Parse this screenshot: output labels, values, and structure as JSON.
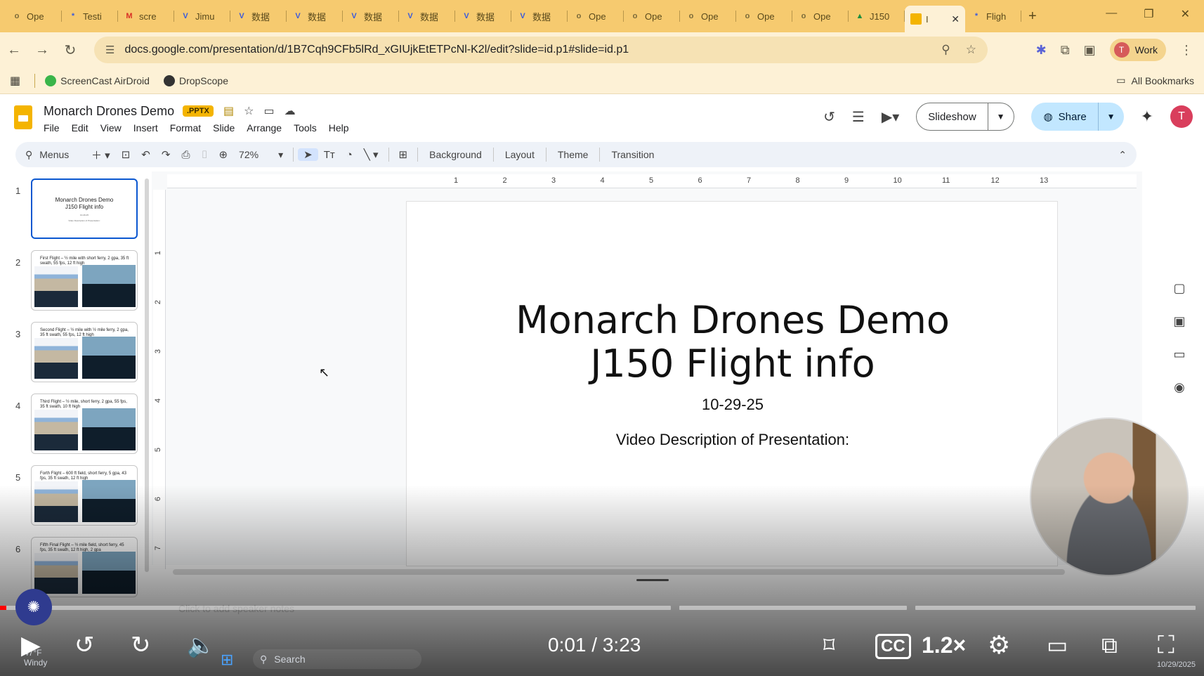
{
  "browser": {
    "tabs": [
      {
        "label": "Ope",
        "fav": "o",
        "color": "#7a6a3a"
      },
      {
        "label": "Testi",
        "fav": "*",
        "color": "#3b5bdb"
      },
      {
        "label": "scre",
        "fav": "M",
        "color": "#d93025"
      },
      {
        "label": "Jimu",
        "fav": "V",
        "color": "#3b5bdb"
      },
      {
        "label": "数据",
        "fav": "V",
        "color": "#3b5bdb"
      },
      {
        "label": "数据",
        "fav": "V",
        "color": "#3b5bdb"
      },
      {
        "label": "数据",
        "fav": "V",
        "color": "#3b5bdb"
      },
      {
        "label": "数据",
        "fav": "V",
        "color": "#3b5bdb"
      },
      {
        "label": "数据",
        "fav": "V",
        "color": "#3b5bdb"
      },
      {
        "label": "数据",
        "fav": "V",
        "color": "#3b5bdb"
      },
      {
        "label": "Ope",
        "fav": "o",
        "color": "#7a6a3a"
      },
      {
        "label": "Ope",
        "fav": "o",
        "color": "#7a6a3a"
      },
      {
        "label": "Ope",
        "fav": "o",
        "color": "#7a6a3a"
      },
      {
        "label": "Ope",
        "fav": "o",
        "color": "#7a6a3a"
      },
      {
        "label": "Ope",
        "fav": "o",
        "color": "#7a6a3a"
      },
      {
        "label": "J150",
        "fav": "▲",
        "color": "#1e8e3e"
      }
    ],
    "active_tab": {
      "label": "I"
    },
    "last_tab": {
      "label": "Fligh"
    },
    "url": "docs.google.com/presentation/d/1B7Cqh9CFb5lRd_xGIUjkEtETPcNl-K2l/edit?slide=id.p1#slide=id.p1",
    "profile_label": "Work",
    "profile_initial": "T",
    "bookmarks": [
      {
        "label": "ScreenCast AirDroid",
        "color": "#3ab54a"
      },
      {
        "label": "DropScope",
        "color": "#333333"
      }
    ],
    "all_bookmarks": "All Bookmarks"
  },
  "slides_app": {
    "title": "Monarch Drones Demo",
    "badge": ".PPTX",
    "menu": [
      "File",
      "Edit",
      "View",
      "Insert",
      "Format",
      "Slide",
      "Arrange",
      "Tools",
      "Help"
    ],
    "slideshow_label": "Slideshow",
    "share_label": "Share",
    "user_initial": "T",
    "toolbar": {
      "search_label": "Menus",
      "zoom": "72%",
      "background": "Background",
      "layout": "Layout",
      "theme": "Theme",
      "transition": "Transition"
    },
    "ruler_h": [
      "1",
      "2",
      "3",
      "4",
      "5",
      "6",
      "7",
      "8",
      "9",
      "10",
      "11",
      "12",
      "13"
    ],
    "ruler_v": [
      "1",
      "2",
      "3",
      "4",
      "5",
      "6",
      "7"
    ],
    "thumbnails": [
      {
        "num": "1",
        "kind": "title",
        "line1": "Monarch Drones Demo",
        "line2": "J150 Flight info",
        "date": "10-29-25",
        "desc": "Video Description of Presentation:"
      },
      {
        "num": "2",
        "kind": "content",
        "caption": "First Flight – ½ mile with short ferry, 2 gpa, 35 ft swath, 55 fps, 12 ft high"
      },
      {
        "num": "3",
        "kind": "content",
        "caption": "Second Flight – ½ mile with ½ mile ferry, 2 gpa, 35 ft swath, 55 fps, 12 ft high"
      },
      {
        "num": "4",
        "kind": "content",
        "caption": "Third Flight – ½ mile, short ferry, 2 gpa, 55 fps, 35 ft swath, 10 ft high"
      },
      {
        "num": "5",
        "kind": "content",
        "caption": "Forth Flight – 600 ft field, short ferry, 5 gpa, 43 fps, 35 ft swath, 12 ft high"
      },
      {
        "num": "6",
        "kind": "content",
        "caption": "Fifth Final Flight – ½ mile field, short ferry, 45 fps, 35 ft swath, 12 ft high, 2 gpa"
      }
    ],
    "slide": {
      "title_line1": "Monarch Drones Demo",
      "title_line2": "J150 Flight info",
      "date": "10-29-25",
      "description": "Video Description of Presentation:"
    },
    "speaker_notes_placeholder": "Click to add speaker notes"
  },
  "video_player": {
    "current_time": "0:01",
    "separator": " / ",
    "duration": "3:23",
    "speed": "1.2×",
    "played_fraction": 0.005
  },
  "taskbar": {
    "weather_temp": "47°F",
    "weather_desc": "Windy",
    "search_placeholder": "Search",
    "date": "10/29/2025"
  }
}
